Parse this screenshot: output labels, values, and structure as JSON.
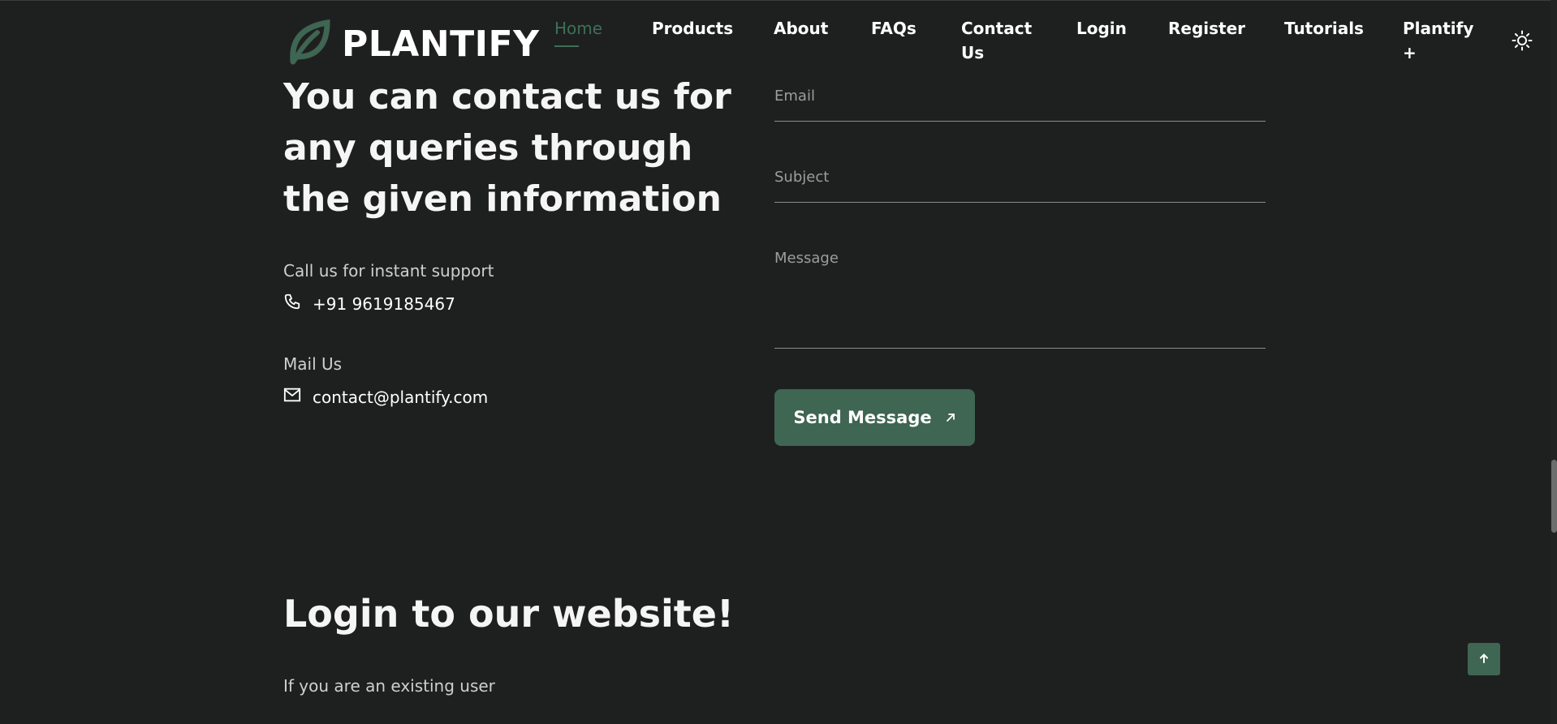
{
  "header": {
    "brand": "PLANTIFY",
    "nav": [
      {
        "label": "Home"
      },
      {
        "label": "Products"
      },
      {
        "label": "About"
      },
      {
        "label": "FAQs"
      },
      {
        "label": "Contact Us"
      },
      {
        "label": "Login"
      },
      {
        "label": "Register"
      },
      {
        "label": "Tutorials"
      },
      {
        "label": "Plantify +"
      }
    ],
    "theme_icon": "sun-icon"
  },
  "contact": {
    "title": "You can contact us for any queries through the given information",
    "call_label": "Call us for instant support",
    "phone": "+91 9619185467",
    "mail_label": "Mail Us",
    "email": "contact@plantify.com"
  },
  "form": {
    "email_placeholder": "Email",
    "subject_placeholder": "Subject",
    "message_placeholder": "Message",
    "send_label": "Send Message"
  },
  "login": {
    "title": "Login to our website!",
    "subtitle": "If you are an existing user"
  },
  "colors": {
    "background": "#1e201f",
    "accent": "#3f6553",
    "active_nav": "#3f6f58"
  }
}
